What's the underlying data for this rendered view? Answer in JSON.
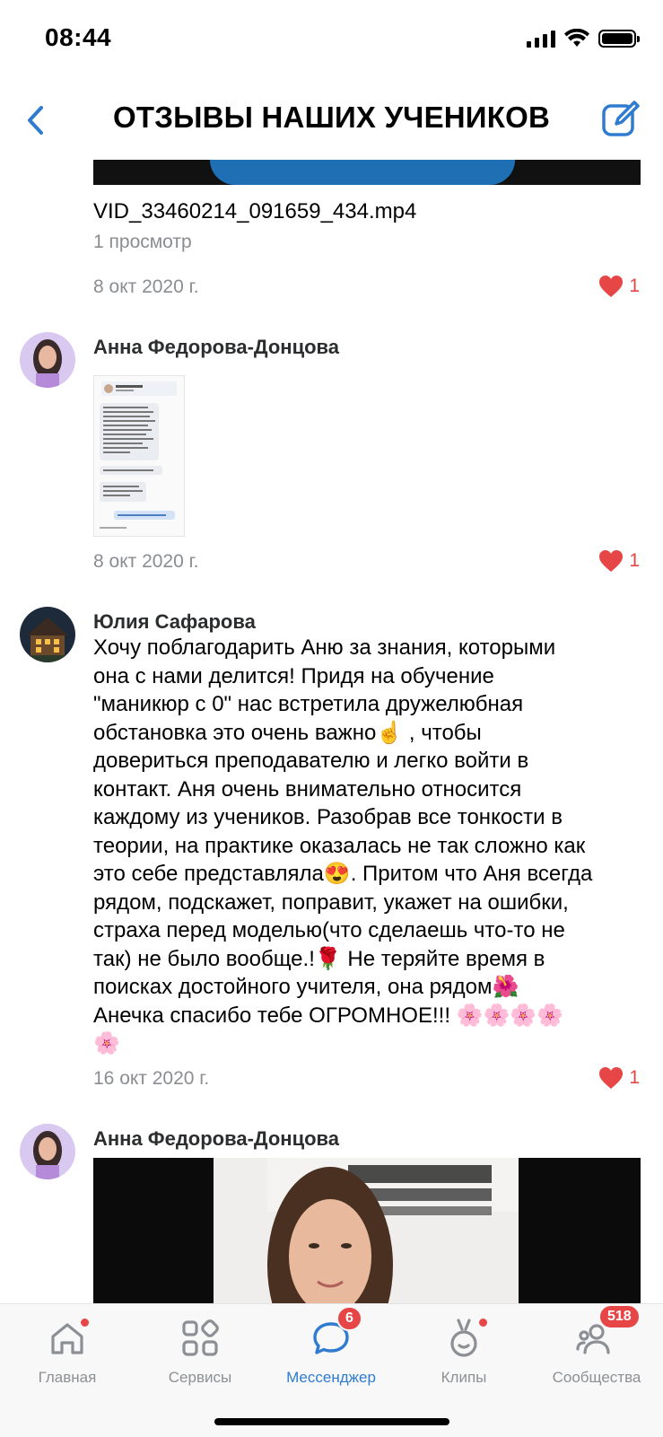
{
  "status_bar": {
    "time": "08:44"
  },
  "header": {
    "title": "ОТЗЫВЫ НАШИХ УЧЕНИКОВ"
  },
  "posts": [
    {
      "file_name": "VID_33460214_091659_434.mp4",
      "views": "1 просмотр",
      "date": "8 окт 2020 г.",
      "likes": "1"
    },
    {
      "author": "Анна Федорова-Донцова",
      "date": "8 окт 2020 г.",
      "likes": "1"
    },
    {
      "author": "Юлия Сафарова",
      "text": "Хочу поблагодарить Аню за знания, которыми\nона с нами делится! Придя на обучение\n\"маникюр с 0\" нас встретила дружелюбная\nобстановка это очень важно☝️ , чтобы\nдовериться преподавателю и легко войти в\nконтакт. Аня очень внимательно относится\nкаждому из учеников. Разобрав все тонкости в\nтеории, на практике оказалась не так сложно как\nэто себе представляла😍. Притом что Аня всегда\nрядом, подскажет, поправит, укажет на ошибки,\nстраха перед моделью(что сделаешь что-то не\nтак) не было вообще.!🌹 Не теряйте время в\nпоисках достойного учителя, она рядом🌺\nАнечка спасибо тебе ОГРОМНОЕ!!! 🌸🌸🌸🌸\n🌸",
      "date": "16 окт 2020 г.",
      "likes": "1"
    },
    {
      "author": "Анна Федорова-Донцова"
    }
  ],
  "tabs": [
    {
      "label": "Главная",
      "icon": "home-icon",
      "dot": true
    },
    {
      "label": "Сервисы",
      "icon": "services-icon"
    },
    {
      "label": "Мессенджер",
      "icon": "messenger-icon",
      "badge": "6",
      "active": true
    },
    {
      "label": "Клипы",
      "icon": "clips-icon",
      "dot": true
    },
    {
      "label": "Сообщества",
      "icon": "communities-icon",
      "badge": "518"
    }
  ],
  "colors": {
    "accent": "#2f7bd0",
    "like": "#e64646",
    "secondary_text": "#8a8d91",
    "badge": "#e64646"
  }
}
